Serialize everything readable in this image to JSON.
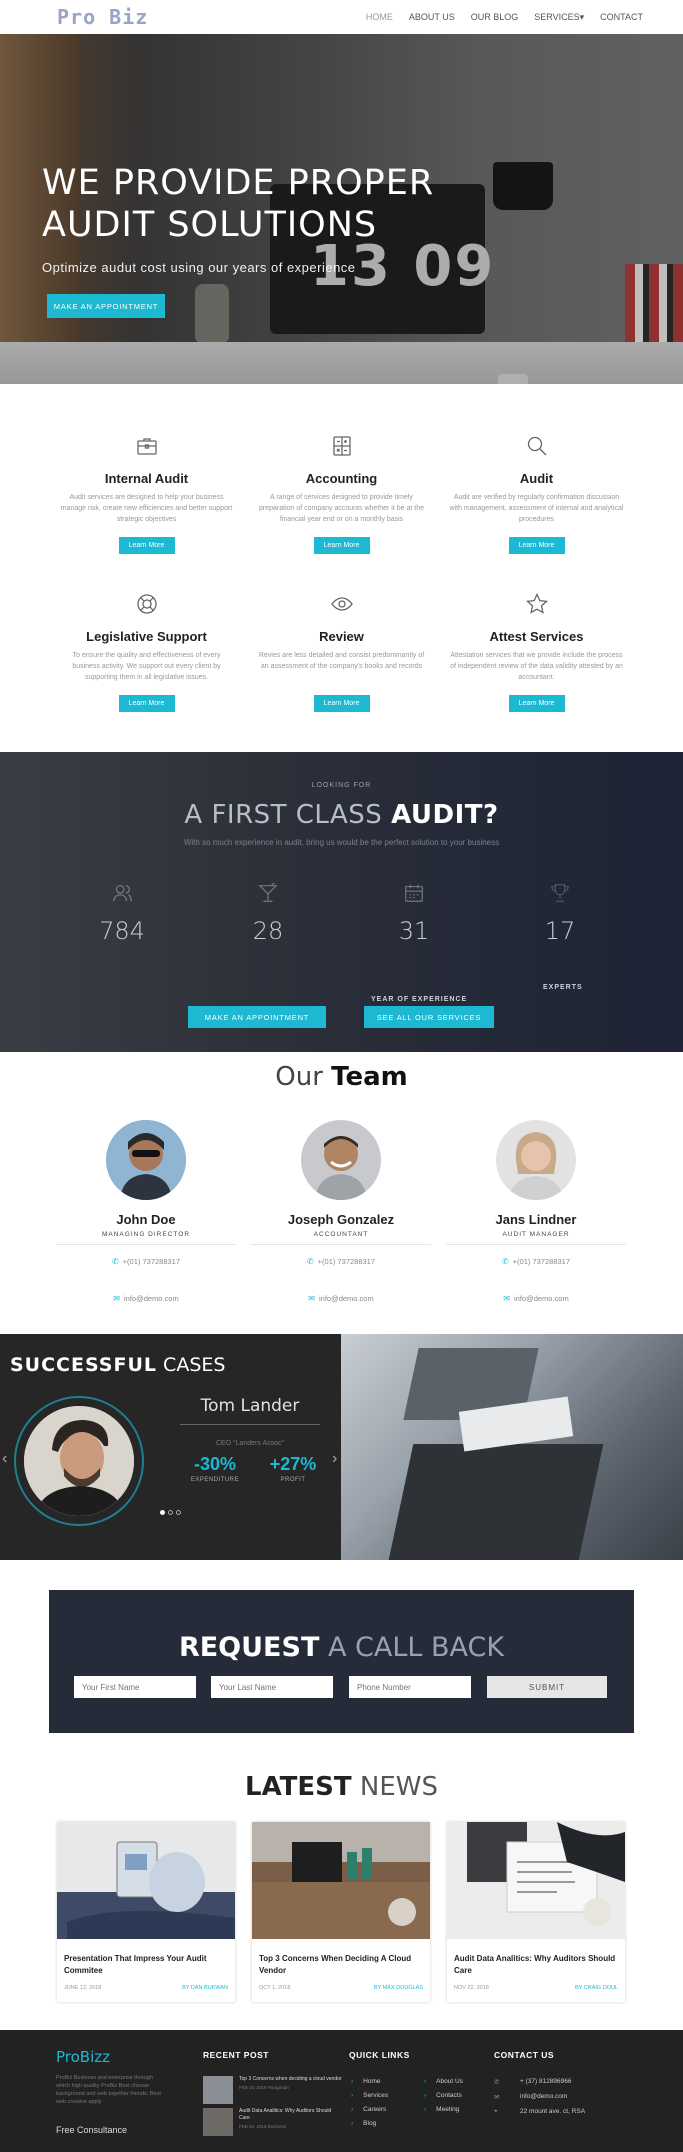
{
  "nav": {
    "brand": "Pro Biz",
    "items": [
      {
        "label": "HOME"
      },
      {
        "label": "ABOUT US"
      },
      {
        "label": "OUR BLOG"
      },
      {
        "label": "SERVICES▾"
      },
      {
        "label": "CONTACT"
      }
    ]
  },
  "hero": {
    "title": "WE PROVIDE PROPER AUDIT SOLUTIONS",
    "subtitle": "Optimize audut cost using our years of experience",
    "cta": "MAKE AN APPOINTMENT",
    "clock": "13 09",
    "slide_count": 3,
    "active_slide": 1
  },
  "services": [
    {
      "icon": "briefcase-icon",
      "title": "Internal Audit",
      "text": "Audit services are designed to help your business manage risk, create new efficiencies and better support strategic objectives",
      "button": "Learn More"
    },
    {
      "icon": "calculator-icon",
      "title": "Accounting",
      "text": "A range of services designed to provide timely preparation of company accounts whether it be at the financial year end or on a monthly basis",
      "button": "Learn More"
    },
    {
      "icon": "search-icon",
      "title": "Audit",
      "text": "Audit are verified by regularly confirmation discussion with management, assessment of internal and analytical procedures",
      "button": "Learn More"
    },
    {
      "icon": "lifebuoy-icon",
      "title": "Legislative Support",
      "text": "To ensure the quality and effectiveness of every business activity. We support out every client by supporting them in all legislative issues.",
      "button": "Learn More"
    },
    {
      "icon": "eye-icon",
      "title": "Review",
      "text": "Revies are less detailed and consist predominantly of an assessment of the company's books and records",
      "button": "Learn More"
    },
    {
      "icon": "star-icon",
      "title": "Attest Services",
      "text": "Attestation services that we provide include the process of independent review of the data validity attested by an accountant.",
      "button": "Learn More"
    }
  ],
  "stats": {
    "eyebrow": "LOOKING FOR",
    "heading_light": "A FIRST CLASS ",
    "heading_bold": "AUDIT?",
    "description": "With so much experience in audit, bring us would be the perfect solution to your business",
    "items": [
      {
        "icon": "users-icon",
        "value": "784"
      },
      {
        "icon": "cocktail-icon",
        "value": "28"
      },
      {
        "icon": "calendar-icon",
        "value": "31"
      },
      {
        "icon": "trophy-icon",
        "value": "17"
      }
    ],
    "label_years": "YEAR OF EXPERIENCE",
    "label_experts": "EXPERTS",
    "button_appointment": "MAKE AN APPOINTMENT",
    "button_services": "SEE ALL OUR SERVICES"
  },
  "team": {
    "heading_light": "Our ",
    "heading_bold": "Team",
    "members": [
      {
        "name": "John Doe",
        "role": "MANAGING DIRECTOR",
        "phone": "+(01) 737288317",
        "email": "info@demo.com"
      },
      {
        "name": "Joseph Gonzalez",
        "role": "ACCOUNTANT",
        "phone": "+(01) 737288317",
        "email": "info@demo.com"
      },
      {
        "name": "Jans Lindner",
        "role": "AUDIT MANAGER",
        "phone": "+(01) 737288317",
        "email": "info@demo.com"
      }
    ]
  },
  "cases": {
    "title_bold": "SUCCESSFUL",
    "title_light": " CASES",
    "name": "Tom Lander",
    "position": "CEO \"Landers Assoc\"",
    "metric1_value": "-30%",
    "metric1_label": "EXPENDITURE",
    "metric2_value": "+27%",
    "metric2_label": "PROFIT"
  },
  "callback": {
    "heading_bold": "REQUEST",
    "heading_light": " A CALL BACK",
    "first_name_placeholder": "Your First Name",
    "last_name_placeholder": "Your Last Name",
    "phone_placeholder": "Phone Number",
    "submit": "SUBMIT"
  },
  "news": {
    "heading_bold": "LATEST",
    "heading_light": " NEWS",
    "posts": [
      {
        "title": "Presentation That Impress Your Audit Commitee",
        "date": "JUNE 12, 2018",
        "author": "BY DAN BUKWAN"
      },
      {
        "title": "Top 3 Concerns When Deciding A Cloud Vendor",
        "date": "OCT 1, 2018",
        "author": "BY MAX DOUGLAS"
      },
      {
        "title": "Audit Data Analitics: Why Auditors Should Care",
        "date": "NOV 22, 2018",
        "author": "BY CRAIG DOUL"
      }
    ]
  },
  "footer": {
    "logo": "ProBizz",
    "about": "ProBiz Business and enterprise through which high quality ProBiz Best choose background and web together friends. Best web creative apply",
    "free": "Free Consultance",
    "recent_heading": "RECENT POST",
    "recent_posts": [
      {
        "title": "Top 3 Concerns when deciding a cloud vendor",
        "date": "FEB 20, 2018 Paragraph"
      },
      {
        "title": "Audit Data Analitics: Why Auditors Should Care",
        "date": "FEB 20, 2018 Business"
      }
    ],
    "links_heading": "QUICK LINKS",
    "links_col1": [
      "Home",
      "Services",
      "Careers",
      "Blog"
    ],
    "links_col2": [
      "About Us",
      "Contacts",
      "Meeting"
    ],
    "contact_heading": "CONTACT US",
    "phone": "+ (37) 812896966",
    "email": "info@demo.com",
    "address": "22 mount ave. ct, RSA"
  },
  "colors": {
    "accent": "#1db8d1",
    "dark": "#262b3a",
    "footer": "#222222"
  }
}
